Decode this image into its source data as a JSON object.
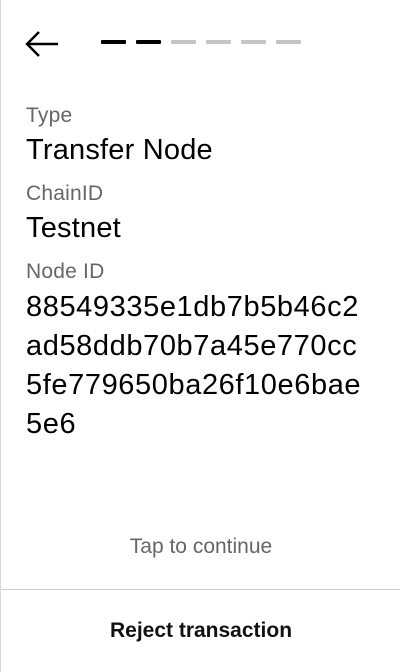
{
  "header": {
    "back_icon": "arrow-left-icon",
    "progress": {
      "total_steps": 6,
      "completed_steps": 2,
      "active_color": "#000000",
      "inactive_color": "#c4c4c4"
    }
  },
  "details": {
    "type_label": "Type",
    "type_value": "Transfer Node",
    "chain_label": "ChainID",
    "chain_value": "Testnet",
    "node_label": "Node ID",
    "node_value": "88549335e1db7b5b46c2ad58ddb70b7a45e770cc5fe779650ba26f10e6bae5e6"
  },
  "footer": {
    "tap_to_continue": "Tap to continue",
    "reject_label": "Reject transaction"
  }
}
